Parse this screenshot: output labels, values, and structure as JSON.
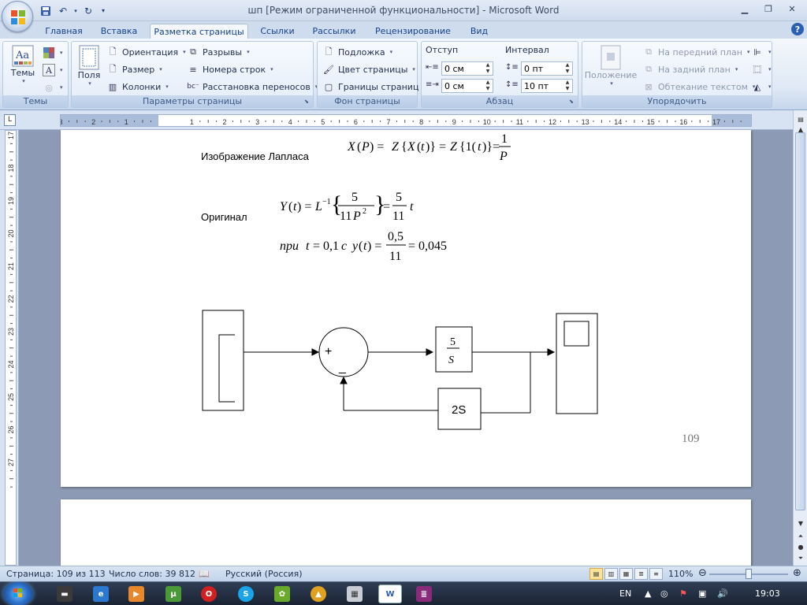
{
  "window": {
    "title": "шп [Режим ограниченной функциональности] - Microsoft Word"
  },
  "tabs": [
    "Главная",
    "Вставка",
    "Разметка страницы",
    "Ссылки",
    "Рассылки",
    "Рецензирование",
    "Вид"
  ],
  "active_tab": "Разметка страницы",
  "ribbon": {
    "themes": {
      "big_label": "Темы",
      "group_label": "Темы"
    },
    "page_setup": {
      "fields_label": "Поля",
      "orientation": "Ориентация",
      "size": "Размер",
      "columns": "Колонки",
      "breaks": "Разрывы",
      "line_numbers": "Номера строк",
      "hyphenation": "Расстановка переносов",
      "group_label": "Параметры страницы"
    },
    "page_background": {
      "watermark": "Подложка",
      "page_color": "Цвет страницы",
      "page_borders": "Границы страниц",
      "group_label": "Фон страницы"
    },
    "paragraph": {
      "indent_label": "Отступ",
      "spacing_label": "Интервал",
      "indent_left": "0 см",
      "indent_right": "0 см",
      "spacing_before": "0 пт",
      "spacing_after": "10 пт",
      "group_label": "Абзац"
    },
    "arrange": {
      "position": "Положение",
      "bring_front": "На передний план",
      "send_back": "На задний план",
      "text_wrap": "Обтекание текстом",
      "group_label": "Упорядочить"
    }
  },
  "ruler": {
    "h_ticks": [
      "3",
      "2",
      "1",
      "1",
      "2",
      "3",
      "4",
      "5",
      "6",
      "7",
      "8",
      "9",
      "10",
      "11",
      "12",
      "13",
      "14",
      "15",
      "16",
      "17"
    ],
    "v_ticks": [
      "17",
      "18",
      "19",
      "20",
      "21",
      "22",
      "23",
      "24",
      "25",
      "26",
      "27"
    ]
  },
  "document": {
    "laplace_label": "Изображение Лапласа",
    "original_label": "Оригинал",
    "page_number": "109",
    "block_tf": {
      "num": "5",
      "den": "S"
    },
    "block_feedback": "2S",
    "sum_plus": "+",
    "sum_minus": "_"
  },
  "status": {
    "page": "Страница: 109 из 113",
    "words": "Число слов: 39 812",
    "language": "Русский (Россия)",
    "zoom": "110%"
  },
  "taskbar": {
    "lang": "EN",
    "time": "19:03"
  }
}
